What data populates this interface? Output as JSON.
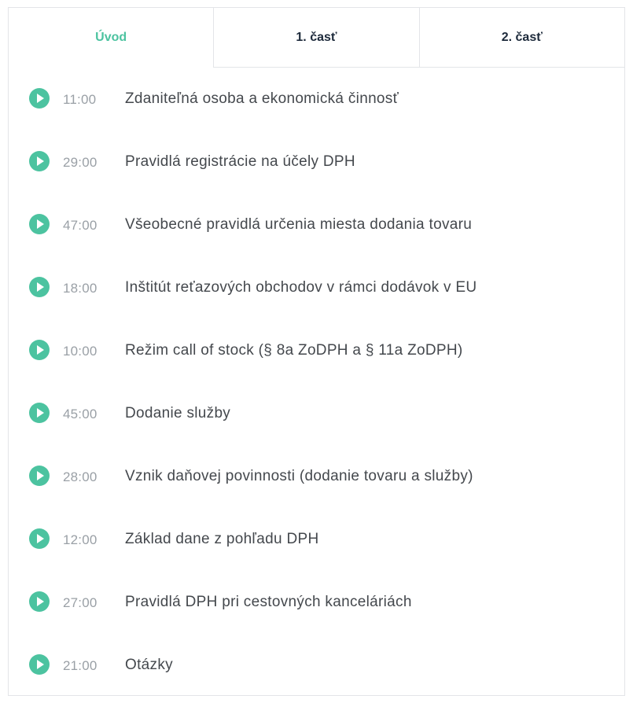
{
  "colors": {
    "accent": "#4cc3a0",
    "tab_text": "#1d2a3b",
    "time_text": "#9aa0a6",
    "title_text": "#44484d",
    "border": "#e3e5e8"
  },
  "tabs": [
    {
      "label": "Úvod",
      "active": true
    },
    {
      "label": "1. časť",
      "active": false
    },
    {
      "label": "2. časť",
      "active": false
    }
  ],
  "items": [
    {
      "icon": "play-icon",
      "time": "11:00",
      "title": "Zdaniteľná osoba a ekonomická činnosť"
    },
    {
      "icon": "play-icon",
      "time": "29:00",
      "title": "Pravidlá registrácie na účely DPH"
    },
    {
      "icon": "play-icon",
      "time": "47:00",
      "title": "Všeobecné pravidlá určenia miesta dodania tovaru"
    },
    {
      "icon": "play-icon",
      "time": "18:00",
      "title": "Inštitút reťazových obchodov v rámci dodávok v EU"
    },
    {
      "icon": "play-icon",
      "time": "10:00",
      "title": "Režim call of stock (§ 8a ZoDPH a § 11a ZoDPH)"
    },
    {
      "icon": "play-icon",
      "time": "45:00",
      "title": "Dodanie služby"
    },
    {
      "icon": "play-icon",
      "time": "28:00",
      "title": "Vznik daňovej povinnosti (dodanie tovaru a služby)"
    },
    {
      "icon": "play-icon",
      "time": "12:00",
      "title": "Základ dane z pohľadu DPH"
    },
    {
      "icon": "play-icon",
      "time": "27:00",
      "title": "Pravidlá DPH pri cestovných kanceláriách"
    },
    {
      "icon": "play-icon",
      "time": "21:00",
      "title": "Otázky"
    }
  ]
}
